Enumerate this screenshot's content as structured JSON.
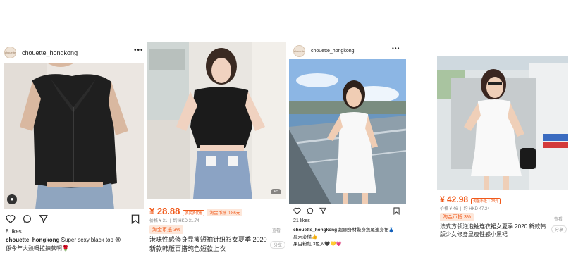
{
  "posts": [
    {
      "account": "chouette_hongkong",
      "avatar_text": "chouette",
      "likes": "8 likes",
      "caption_user": "chouette_hongkong",
      "caption_text": "Super sexy black top 😍",
      "caption_line2": "係今年大熱嘅拉鍊款啊🌹"
    },
    {
      "price": "¥ 28.88",
      "tag1": "多买多优惠",
      "tag2": "淘金币抵 0.86元",
      "orig_price": "价格 ¥ 31",
      "approx": "约 HKD 31.74",
      "coin": "淘金币抵 3%",
      "title": "港味性感修身显瘦短袖针织衫女夏季 2020 新款韩版百搭纯色短款上衣",
      "side": "查看",
      "share": "分享",
      "counter": "4/5"
    },
    {
      "account": "chouette_hongkong",
      "avatar_text": "chouette",
      "likes": "21 likes",
      "caption_user": "chouette_hongkong",
      "caption_text": "超顯身材繁身魚尾連身裙👗",
      "caption_line2": "夏天必備👍",
      "caption_line3": "果白粉紅 3色入🖤💛💗"
    },
    {
      "price": "¥ 42.98",
      "tag1": "淘金币抵 1.28元",
      "orig_price": "价格 ¥ 46",
      "approx": "约 HKD 47.24",
      "coin": "淘金币抵 3%",
      "title": "法式方领泡泡袖连衣裙女夏季 2020 新款韩版少女修身显瘦性感小黑裙",
      "side": "查看",
      "share": "分享"
    }
  ],
  "colors": {
    "price": "#f0591a",
    "bg": "#ffffff"
  },
  "icons": [
    "heart-icon",
    "comment-icon",
    "send-icon",
    "bookmark-icon",
    "more-icon",
    "user-tag-icon"
  ]
}
